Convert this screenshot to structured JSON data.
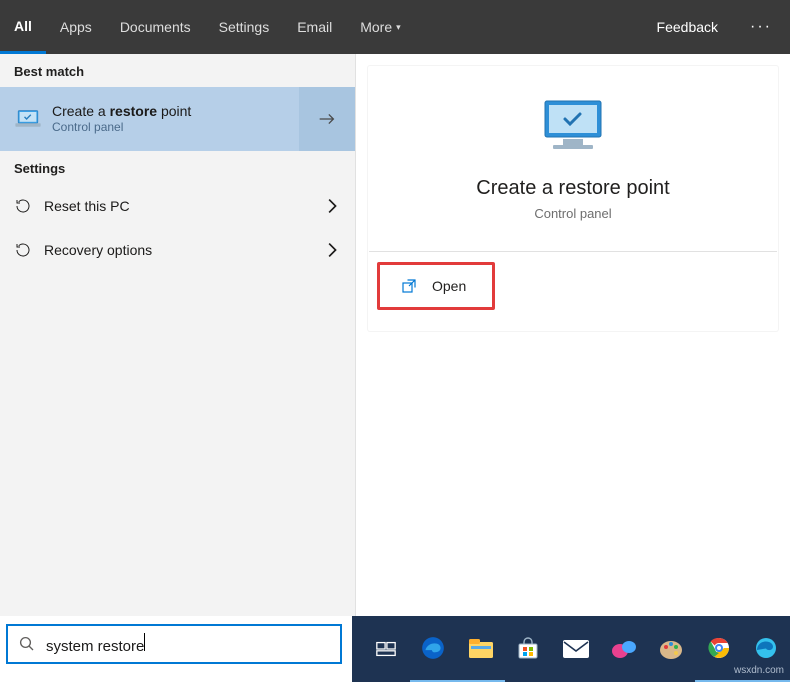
{
  "topbar": {
    "tabs": [
      "All",
      "Apps",
      "Documents",
      "Settings",
      "Email",
      "More"
    ],
    "active_index": 0,
    "feedback": "Feedback",
    "more_glyph": "▾",
    "ellipsis_glyph": "···"
  },
  "left": {
    "section_best": "Best match",
    "best_match": {
      "title_pre": "Create a ",
      "title_bold": "restore",
      "title_post": " point",
      "subtitle": "Control panel"
    },
    "section_settings": "Settings",
    "settings_items": [
      {
        "label": "Reset this PC"
      },
      {
        "label": "Recovery options"
      }
    ]
  },
  "right": {
    "title": "Create a restore point",
    "subtitle": "Control panel",
    "open_label": "Open"
  },
  "search": {
    "value": "system restore"
  },
  "watermark": "wsxdn.com"
}
